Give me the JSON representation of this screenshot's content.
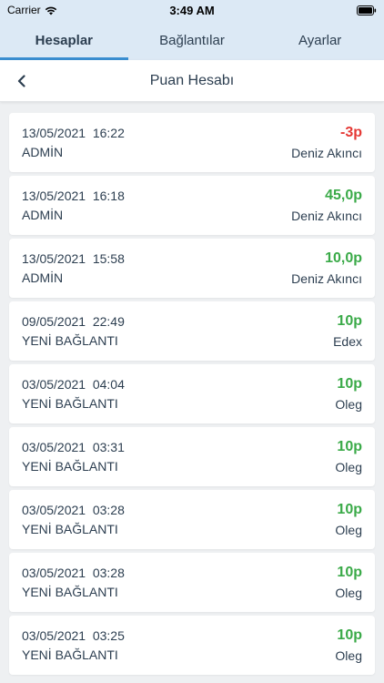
{
  "status_bar": {
    "carrier": "Carrier",
    "time": "3:49 AM"
  },
  "tabs": [
    {
      "label": "Hesaplar",
      "active": true
    },
    {
      "label": "Bağlantılar",
      "active": false
    },
    {
      "label": "Ayarlar",
      "active": false
    }
  ],
  "navbar": {
    "title": "Puan Hesabı"
  },
  "colors": {
    "positive": "#3aaa48",
    "negative": "#e53935",
    "accent": "#3a8fd1"
  },
  "transactions": [
    {
      "date": "13/05/2021  16:22",
      "type": "ADMİN",
      "points": "-3p",
      "user": "Deniz Akıncı",
      "sign": "negative"
    },
    {
      "date": "13/05/2021  16:18",
      "type": "ADMİN",
      "points": "45,0p",
      "user": "Deniz Akıncı",
      "sign": "positive"
    },
    {
      "date": "13/05/2021  15:58",
      "type": "ADMİN",
      "points": "10,0p",
      "user": "Deniz Akıncı",
      "sign": "positive"
    },
    {
      "date": "09/05/2021  22:49",
      "type": "YENİ BAĞLANTI",
      "points": "10p",
      "user": "Edex",
      "sign": "positive"
    },
    {
      "date": "03/05/2021  04:04",
      "type": "YENİ BAĞLANTI",
      "points": "10p",
      "user": "Oleg",
      "sign": "positive"
    },
    {
      "date": "03/05/2021  03:31",
      "type": "YENİ BAĞLANTI",
      "points": "10p",
      "user": "Oleg",
      "sign": "positive"
    },
    {
      "date": "03/05/2021  03:28",
      "type": "YENİ BAĞLANTI",
      "points": "10p",
      "user": "Oleg",
      "sign": "positive"
    },
    {
      "date": "03/05/2021  03:28",
      "type": "YENİ BAĞLANTI",
      "points": "10p",
      "user": "Oleg",
      "sign": "positive"
    },
    {
      "date": "03/05/2021  03:25",
      "type": "YENİ BAĞLANTI",
      "points": "10p",
      "user": "Oleg",
      "sign": "positive"
    }
  ]
}
